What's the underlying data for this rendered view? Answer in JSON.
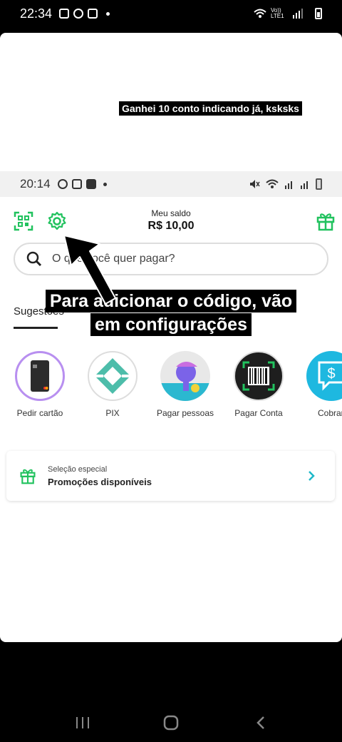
{
  "outer_status": {
    "time": "22:34",
    "network_label": "Vo)) LTE1"
  },
  "top_caption": "Ganhei 10 conto indicando já, ksksks",
  "inner_status": {
    "time": "20:14"
  },
  "header": {
    "balance_label": "Meu saldo",
    "balance_value": "R$ 10,00"
  },
  "search": {
    "placeholder": "O que você quer pagar?"
  },
  "tabs": {
    "active_label": "Sugestões"
  },
  "overlay_caption": {
    "line1": "Para adicionar o código, vão",
    "line2": "em configurações"
  },
  "shortcuts": [
    {
      "label": "Pedir cartão"
    },
    {
      "label": "PIX"
    },
    {
      "label": "Pagar pessoas"
    },
    {
      "label": "Pagar Conta"
    },
    {
      "label": "Cobrar"
    }
  ],
  "promo": {
    "small": "Seleção especial",
    "title": "Promoções disponíveis"
  },
  "colors": {
    "accent": "#21c25e",
    "teal": "#1eb8c9"
  }
}
